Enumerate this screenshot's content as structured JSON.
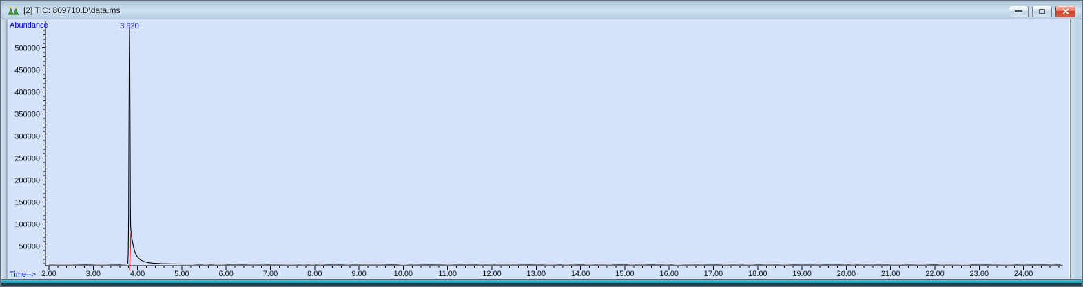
{
  "window": {
    "title": "[2] TIC: 809710.D\\data.ms",
    "icons": {
      "app": "chromatogram-peaks-icon",
      "minimize": "–",
      "maximize": "▢",
      "close": "✕"
    }
  },
  "chart_data": {
    "type": "line",
    "title": "TIC: 809710.D\\data.ms",
    "xlabel": "Time-->",
    "ylabel": "Abundance",
    "xlim": [
      2.0,
      24.9
    ],
    "ylim": [
      0,
      560000
    ],
    "grid": false,
    "x_tick_labels": [
      "2.00",
      "3.00",
      "4.00",
      "5.00",
      "6.00",
      "7.00",
      "8.00",
      "9.00",
      "10.00",
      "11.00",
      "12.00",
      "13.00",
      "14.00",
      "15.00",
      "16.00",
      "17.00",
      "18.00",
      "19.00",
      "20.00",
      "21.00",
      "22.00",
      "23.00",
      "24.00"
    ],
    "x_minor_step": 0.2,
    "y_tick_labels": [
      "50000",
      "100000",
      "150000",
      "200000",
      "250000",
      "300000",
      "350000",
      "400000",
      "450000",
      "500000"
    ],
    "y_minor_step": 10000,
    "plot_bg": "#d4e2fc",
    "trace_color": "#000000",
    "annotation_color": "#0000cc",
    "axis_color": "#000000",
    "peaks": [
      {
        "retention_time": 3.82,
        "label": "3.820",
        "apex_abundance": 548000
      }
    ],
    "baseline_abundance": 9000,
    "baseline_noise_amplitude": 900,
    "peak_trace": [
      [
        3.74,
        9200
      ],
      [
        3.78,
        11000
      ],
      [
        3.79,
        30000
      ],
      [
        3.8,
        120000
      ],
      [
        3.806,
        300000
      ],
      [
        3.813,
        470000
      ],
      [
        3.82,
        548000
      ],
      [
        3.826,
        470000
      ],
      [
        3.833,
        300000
      ],
      [
        3.84,
        140000
      ],
      [
        3.845,
        95000
      ],
      [
        3.85,
        86000
      ],
      [
        3.86,
        78000
      ],
      [
        3.88,
        64000
      ],
      [
        3.91,
        48000
      ],
      [
        3.95,
        34000
      ],
      [
        4.0,
        25000
      ],
      [
        4.06,
        19000
      ],
      [
        4.13,
        15500
      ],
      [
        4.22,
        13000
      ],
      [
        4.35,
        11200
      ],
      [
        4.55,
        10200
      ],
      [
        4.8,
        9700
      ],
      [
        5.05,
        9400
      ]
    ],
    "integration_marker": {
      "color": "#ff0000",
      "points": [
        [
          3.819,
          -6000
        ],
        [
          3.83,
          25000
        ],
        [
          3.85,
          80000
        ]
      ]
    }
  }
}
